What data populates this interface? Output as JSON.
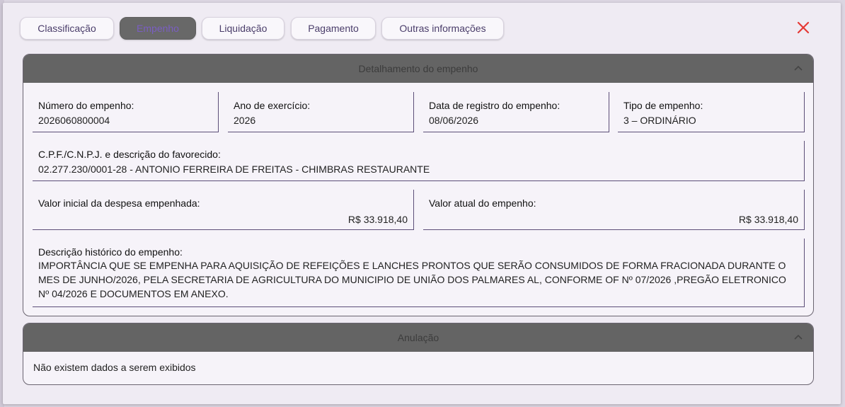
{
  "tabs": [
    {
      "label": "Classificação",
      "active": false
    },
    {
      "label": "Empenho",
      "active": true
    },
    {
      "label": "Liquidação",
      "active": false
    },
    {
      "label": "Pagamento",
      "active": false
    },
    {
      "label": "Outras informações",
      "active": false
    }
  ],
  "close_icon": "close-icon",
  "close_color": "#e53935",
  "detail": {
    "title": "Detalhamento do empenho",
    "numero": {
      "label": "Número do empenho:",
      "value": "2026060800004"
    },
    "ano": {
      "label": "Ano de exercício:",
      "value": "2026"
    },
    "data_registro": {
      "label": "Data de registro do empenho:",
      "value": "08/06/2026"
    },
    "tipo": {
      "label": "Tipo de empenho:",
      "value": "3 – ORDINÁRIO"
    },
    "favorecido": {
      "label": "C.P.F./C.N.P.J. e descrição do favorecido:",
      "value": "02.277.230/0001-28 - ANTONIO FERREIRA DE FREITAS - CHIMBRAS RESTAURANTE"
    },
    "valor_inicial": {
      "label": "Valor inicial da despesa empenhada:",
      "value": "R$ 33.918,40"
    },
    "valor_atual": {
      "label": "Valor atual do empenho:",
      "value": "R$ 33.918,40"
    },
    "historico": {
      "label": "Descrição histórico do empenho:",
      "value": "IMPORTÂNCIA QUE SE EMPENHA PARA AQUISIÇÃO DE REFEIÇÕES E LANCHES PRONTOS QUE SERÃO CONSUMIDOS DE FORMA FRACIONADA DURANTE O MES DE JUNHO/2026, PELA SECRETARIA DE AGRICULTURA DO MUNICIPIO  DE UNIÃO DOS PALMARES AL, CONFORME OF Nº 07/2026 ,PREGÃO ELETRONICO Nº 04/2026 E DOCUMENTOS EM ANEXO."
    }
  },
  "anulacao": {
    "title": "Anulação",
    "empty": "Não existem dados a serem exibidos"
  }
}
